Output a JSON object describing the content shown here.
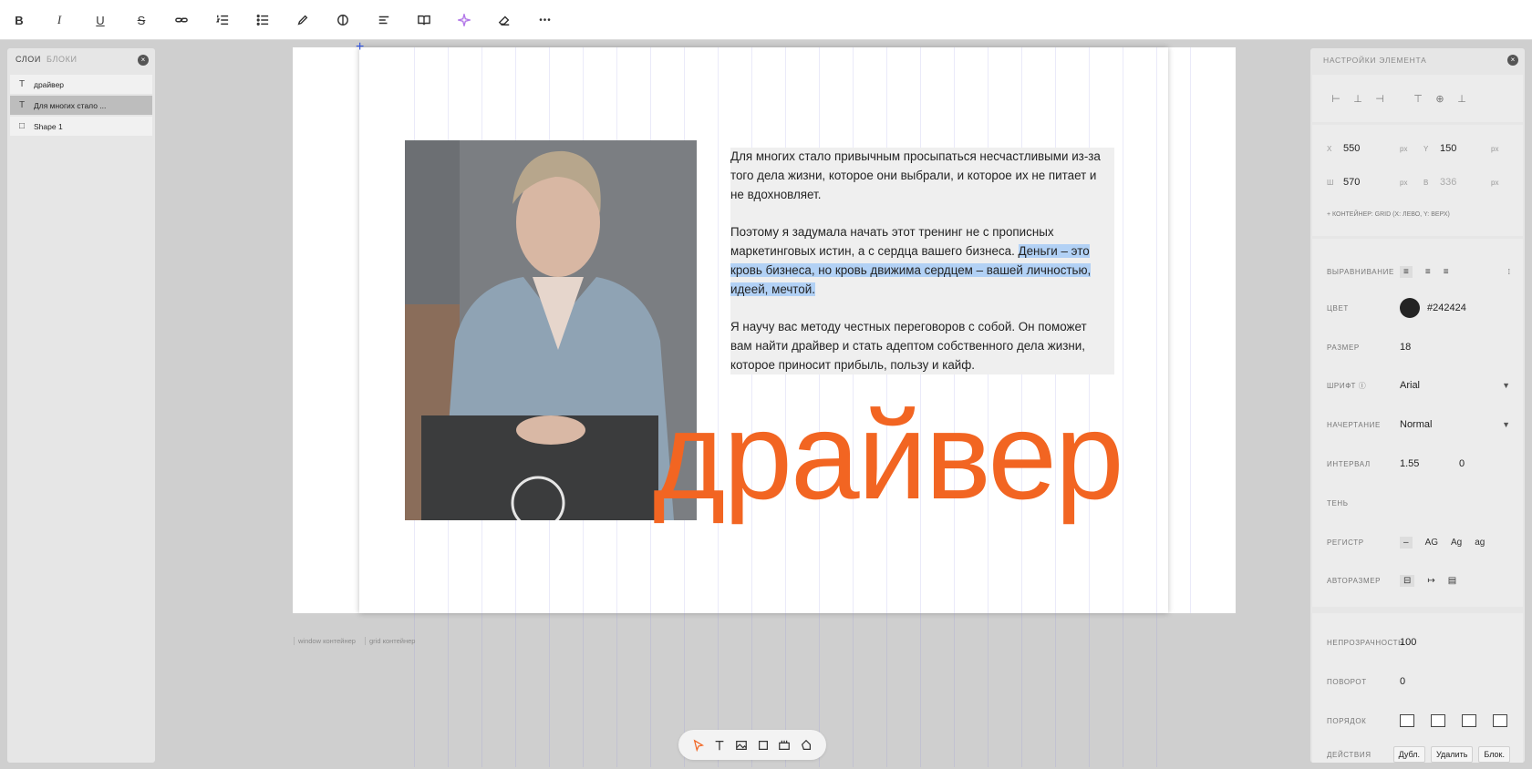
{
  "toolbar": {
    "bold": "B",
    "italic": "I",
    "underline": "U",
    "strike": "S",
    "icons": [
      "link-icon",
      "ordered-list-icon",
      "bullet-list-icon",
      "pen-icon",
      "contrast-icon",
      "paragraph-icon",
      "book-icon",
      "ai-sparkle-icon",
      "eraser-icon",
      "more-icon"
    ],
    "more": "•••"
  },
  "layers": {
    "tab_layers": "СЛОИ",
    "tab_blocks": "БЛОКИ",
    "close": "×",
    "items": [
      {
        "label": "драйвер",
        "icon": "text-layer-icon",
        "glyph": "T"
      },
      {
        "label": "Для многих стало ...",
        "icon": "text-layer-icon",
        "glyph": "T",
        "selected": true
      },
      {
        "label": "Shape 1",
        "icon": "shape-layer-icon",
        "glyph": "□"
      }
    ]
  },
  "canvas": {
    "paragraphs": [
      {
        "text": "Для многих стало привычным просыпаться несчастливыми из-за того дела жизни, которое они выбрали, и которое их не питает и не вдохновляет."
      },
      {
        "text": "Поэтому я задумала начать этот тренинг не с прописных маркетинговых истин, а с сердца вашего бизнеса. ",
        "highlight": "Деньги – это кровь бизнеса, но кровь движима сердцем – вашей личностью, идеей, мечтой."
      },
      {
        "text": "Я научу вас методу честных переговоров с собой. Он поможет вам найти драйвер и стать адептом собственного дела жизни, которое приносит прибыль, пользу и кайф."
      }
    ],
    "big_word": "драйвер",
    "accent_color": "#f26522",
    "label_window": "window контейнер",
    "label_grid": "grid контейнер"
  },
  "bottom_tools": [
    "pointer-icon",
    "text-tool-icon",
    "image-tool-icon",
    "shape-tool-icon",
    "video-tool-icon",
    "hand-tool-icon"
  ],
  "props": {
    "title": "НАСТРОЙКИ ЭЛЕМЕНТА",
    "close": "×",
    "x_label": "X",
    "x_value": "550",
    "y_label": "Y",
    "y_value": "150",
    "w_label": "Ш",
    "w_value": "570",
    "h_label": "В",
    "h_value": "336",
    "unit": "px",
    "container_prefix": "+ КОНТЕЙНЕР:",
    "container_info": "GRID (X: ЛЕВО, Y: ВЕРХ)",
    "align_label": "ВЫРАВНИВАНИЕ",
    "color_label": "ЦВЕТ",
    "color_value": "#242424",
    "size_label": "РАЗМЕР",
    "size_value": "18",
    "font_label": "ШРИФТ",
    "font_value": "Arial",
    "style_label": "НАЧЕРТАНИЕ",
    "style_value": "Normal",
    "interval_label": "ИНТЕРВАЛ",
    "line_height": "1.55",
    "letter_spacing": "0",
    "shadow_label": "ТЕНЬ",
    "case_label": "РЕГИСТР",
    "case_none": "–",
    "case_upper": "AG",
    "case_title": "Ag",
    "case_lower": "ag",
    "autosize_label": "АВТОРАЗМЕР",
    "opacity_label": "НЕПРОЗРАЧНОСТЬ",
    "opacity_value": "100",
    "rotate_label": "ПОВОРОТ",
    "rotate_value": "0",
    "order_label": "ПОРЯДОК",
    "actions_label": "ДЕЙСТВИЯ",
    "dup": "Дубл.",
    "del": "Удалить",
    "lock": "Блок."
  }
}
